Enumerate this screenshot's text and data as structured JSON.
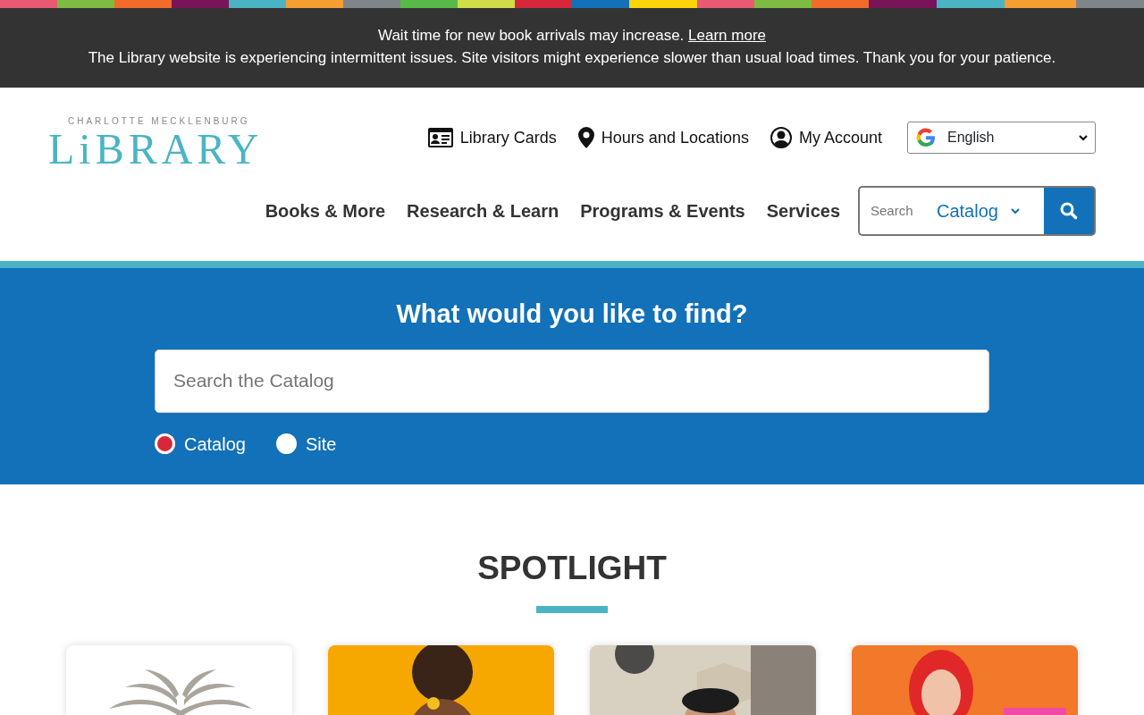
{
  "alert": {
    "line1": "Wait time for new book arrivals may increase.",
    "link": "Learn more",
    "line2": "The Library website is experiencing intermittent issues. Site visitors might experience slower than usual load times. Thank you for your patience."
  },
  "logo": {
    "tagline": "CHARLOTTE MECKLENBURG",
    "name": "LiBRARY"
  },
  "utility_links": [
    {
      "kind": "card",
      "label": "Library Cards"
    },
    {
      "kind": "pin",
      "label": "Hours and Locations"
    },
    {
      "kind": "account",
      "label": "My Account"
    }
  ],
  "language": {
    "value": "English"
  },
  "nav": [
    "Books & More",
    "Research & Learn",
    "Programs & Events",
    "Services"
  ],
  "header_search": {
    "placeholder": "Search",
    "scope": "Catalog"
  },
  "hero": {
    "title": "What would you like to find?",
    "placeholder": "Search the Catalog",
    "options": [
      {
        "label": "Catalog",
        "selected": true
      },
      {
        "label": "Site",
        "selected": false
      }
    ]
  },
  "spotlight": {
    "title": "SPOTLIGHT",
    "cards": [
      {
        "kind": "book"
      },
      {
        "kind": "picture"
      },
      {
        "kind": "picture"
      },
      {
        "kind": "picture"
      }
    ]
  }
}
